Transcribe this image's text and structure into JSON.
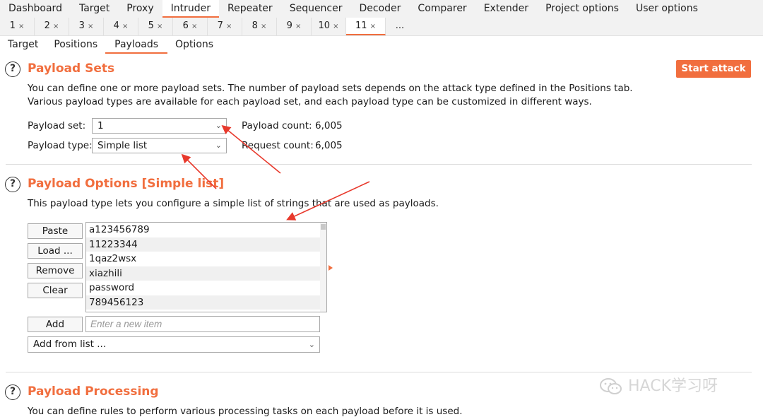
{
  "menu": {
    "tabs": [
      "Dashboard",
      "Target",
      "Proxy",
      "Intruder",
      "Repeater",
      "Sequencer",
      "Decoder",
      "Comparer",
      "Extender",
      "Project options",
      "User options"
    ],
    "active": "Intruder"
  },
  "attack_tabs": {
    "tabs": [
      "1",
      "2",
      "3",
      "4",
      "5",
      "6",
      "7",
      "8",
      "9",
      "10",
      "11"
    ],
    "close_glyph": "×",
    "more": "...",
    "active": "11"
  },
  "sub_tabs": {
    "tabs": [
      "Target",
      "Positions",
      "Payloads",
      "Options"
    ],
    "active": "Payloads"
  },
  "payload_sets": {
    "title": "Payload Sets",
    "description": "You can define one or more payload sets. The number of payload sets depends on the attack type defined in the Positions tab. Various payload types are available for each payload set, and each payload type can be customized in different ways.",
    "start_attack": "Start attack",
    "payload_set_label": "Payload set:",
    "payload_set_value": "1",
    "payload_type_label": "Payload type:",
    "payload_type_value": "Simple list",
    "payload_count_label": "Payload count:",
    "payload_count_value": "6,005",
    "request_count_label": "Request count:",
    "request_count_value": "6,005"
  },
  "payload_options": {
    "title": "Payload Options [Simple list]",
    "description": "This payload type lets you configure a simple list of strings that are used as payloads.",
    "buttons": {
      "paste": "Paste",
      "load": "Load ...",
      "remove": "Remove",
      "clear": "Clear",
      "add": "Add"
    },
    "items": [
      "a123456789",
      "11223344",
      "1qaz2wsx",
      "xiazhili",
      "password",
      "789456123"
    ],
    "add_placeholder": "Enter a new item",
    "add_from_list": "Add from list ..."
  },
  "payload_processing": {
    "title": "Payload Processing",
    "description": "You can define rules to perform various processing tasks on each payload before it is used."
  },
  "help_glyph": "?",
  "watermark": "HACK学习呀",
  "colors": {
    "accent": "#f16e3e",
    "annotation_arrow": "#e8392c"
  },
  "icons": {
    "help": "help-circle-icon",
    "dropdown": "chevron-down-icon",
    "close": "close-icon",
    "watermark_logo": "wechat-icon"
  }
}
